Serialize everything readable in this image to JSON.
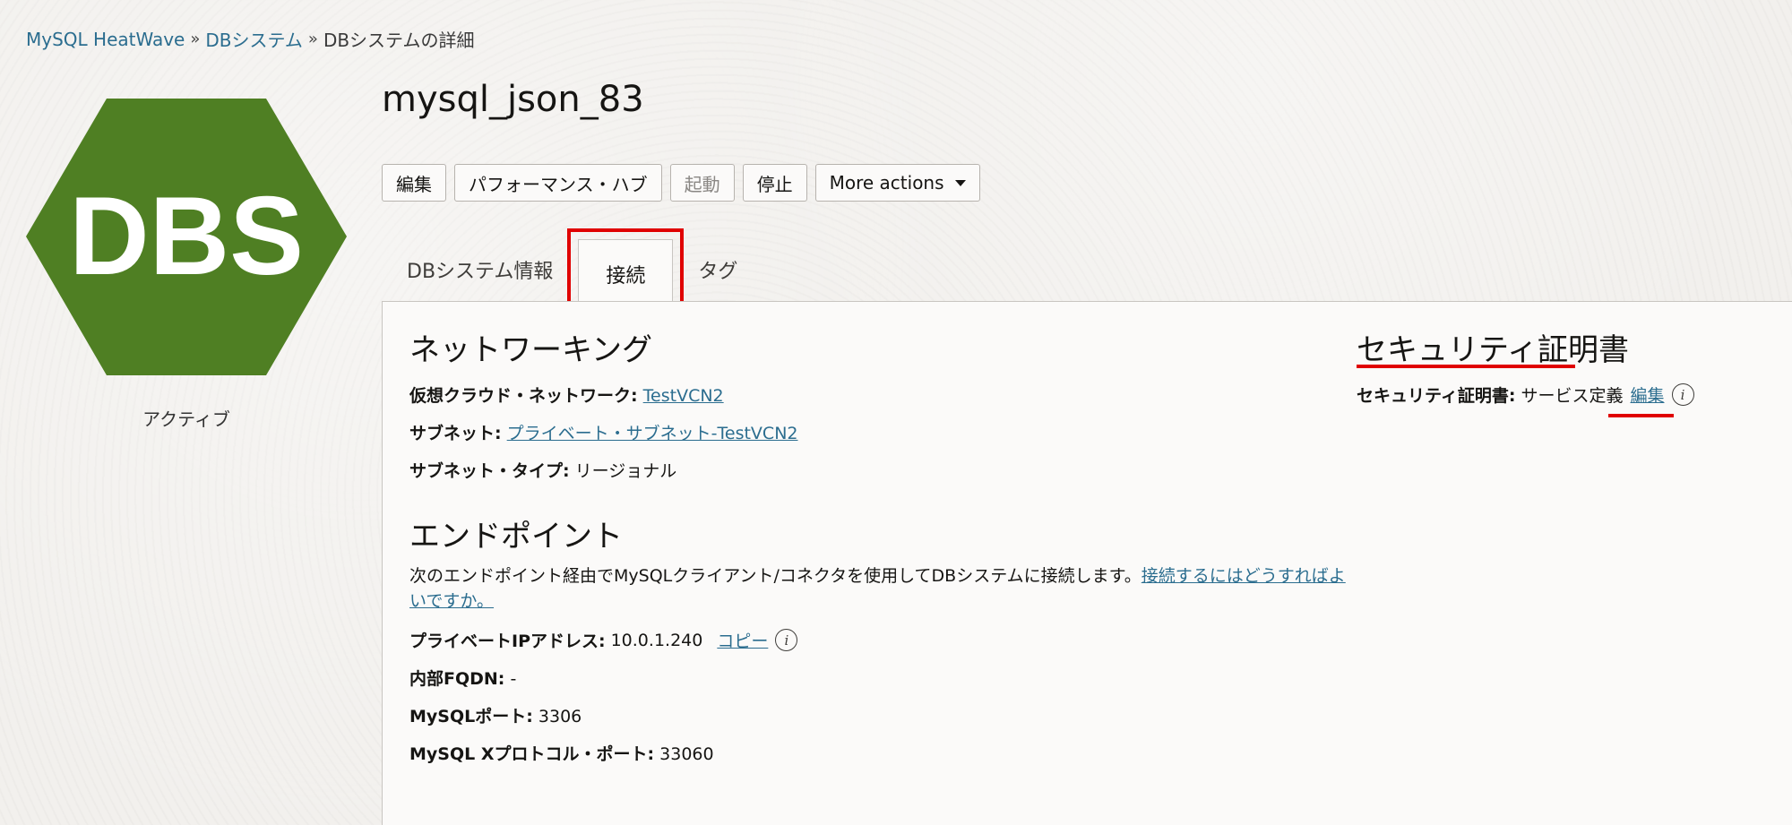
{
  "breadcrumb": {
    "items": [
      "MySQL HeatWave",
      "DBシステム"
    ],
    "current": "DBシステムの詳細",
    "separator": "»"
  },
  "resource": {
    "icon_text": "DBS",
    "icon_color": "#4f7f23",
    "status": "アクティブ",
    "title": "mysql_json_83"
  },
  "actions": {
    "edit": "編集",
    "performance_hub": "パフォーマンス・ハブ",
    "start": "起動",
    "stop": "停止",
    "more": "More actions"
  },
  "tabs": [
    {
      "label": "DBシステム情報",
      "active": false
    },
    {
      "label": "接続",
      "active": true
    },
    {
      "label": "タグ",
      "active": false
    }
  ],
  "networking": {
    "title": "ネットワーキング",
    "vcn_label": "仮想クラウド・ネットワーク:",
    "vcn_value": "TestVCN2",
    "subnet_label": "サブネット:",
    "subnet_value": "プライベート・サブネット-TestVCN2",
    "subnet_type_label": "サブネット・タイプ:",
    "subnet_type_value": "リージョナル"
  },
  "endpoint": {
    "title": "エンドポイント",
    "description": "次のエンドポイント経由でMySQLクライアント/コネクタを使用してDBシステムに接続します。",
    "help_link": "接続するにはどうすればよいですか。",
    "ip_label": "プライベートIPアドレス:",
    "ip_value": "10.0.1.240",
    "copy": "コピー",
    "fqdn_label": "内部FQDN:",
    "fqdn_value": "-",
    "port_label": "MySQLポート:",
    "port_value": "3306",
    "xport_label": "MySQL Xプロトコル・ポート:",
    "xport_value": "33060"
  },
  "security": {
    "title": "セキュリティ証明書",
    "cert_label": "セキュリティ証明書:",
    "cert_value": "サービス定義",
    "edit": "編集"
  },
  "colors": {
    "link": "#2b6d8f",
    "highlight": "#e00000"
  },
  "icons": {
    "info": "info-icon",
    "more_caret": "chevron-down-icon"
  }
}
